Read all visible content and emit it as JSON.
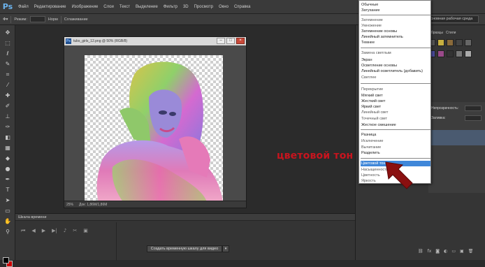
{
  "app": {
    "logo": "Ps"
  },
  "menu": [
    "Файл",
    "Редактирование",
    "Изображение",
    "Слои",
    "Текст",
    "Выделение",
    "Фильтр",
    "3D",
    "Просмотр",
    "Окно",
    "Справка"
  ],
  "options_bar": {
    "mode_label": "Режим:",
    "mode_value": "Норм",
    "checkbox_label": "Сглаживание",
    "workspace": "Основная рабочая среда"
  },
  "document": {
    "title": "tubs_girls_12.png @ 50% (RGB/8)",
    "zoom": "25%",
    "doc_info": "Док: 1,86М/1,86М"
  },
  "timeline": {
    "title": "Шкала времени",
    "create_button": "Создать временную шкалу для видео"
  },
  "right_panel": {
    "tabs": [
      "Образцы",
      "Стили"
    ],
    "layers_blend": "Непрозрачность:",
    "layers_blend_value": "100%",
    "fill_label": "Заливка:",
    "fill_value": "100%"
  },
  "blend_menu": {
    "groups": [
      [
        "Обычные",
        "Затухание"
      ],
      [
        "Затемнение",
        "Умножение",
        "Затемнение основы",
        "Линейный затемнитель",
        "Темнее"
      ],
      [
        "Замена светлым",
        "Экран",
        "Осветление основы",
        "Линейный осветлитель (добавить)",
        "Светлее"
      ],
      [
        "Перекрытие",
        "Мягкий свет",
        "Жесткий свет",
        "Яркий свет",
        "Линейный свет",
        "Точечный свет",
        "Жесткое смешение"
      ],
      [
        "Разница",
        "Исключение",
        "Вычитание",
        "Разделить"
      ],
      [
        "Цветовой тон",
        "Насыщенность",
        "Цветность",
        "Яркость"
      ]
    ],
    "selected": "Цветовой тон"
  },
  "annotation": {
    "text": "цветовой тон",
    "color": "#c8141e"
  },
  "colors": {
    "selection": "#3f87d9",
    "foreground": "#000000",
    "background": "#cc0000"
  }
}
